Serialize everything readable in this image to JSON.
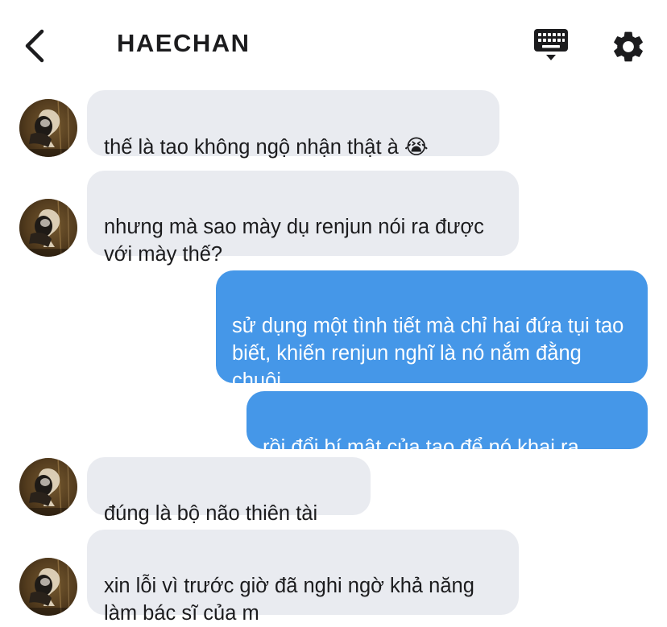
{
  "header": {
    "back_icon": "chevron-left-icon",
    "title": "HAECHAN",
    "keyboard_icon": "keyboard-icon",
    "settings_icon": "gear-icon"
  },
  "messages": [
    {
      "direction": "incoming",
      "text": "thế là tao không ngộ nhận thật à 😭"
    },
    {
      "direction": "incoming",
      "text": "nhưng mà sao mày dụ renjun nói ra được với mày thế?"
    },
    {
      "direction": "outgoing",
      "text": "sử dụng một tình tiết mà chỉ hai đứa tụi tao biết, khiến renjun nghĩ là nó nắm đằng chuôi"
    },
    {
      "direction": "outgoing",
      "text": "rồi đổi bí mật của tao để nó khai ra"
    },
    {
      "direction": "incoming",
      "text": "đúng là bộ não thiên tài"
    },
    {
      "direction": "incoming",
      "text": "xin lỗi vì trước giờ đã nghi ngờ khả năng làm bác sĩ của m"
    }
  ],
  "colors": {
    "incoming_bubble": "#e9ebf0",
    "outgoing_bubble": "#4597e8",
    "outgoing_text": "#ffffff",
    "text": "#1c1c1e"
  }
}
